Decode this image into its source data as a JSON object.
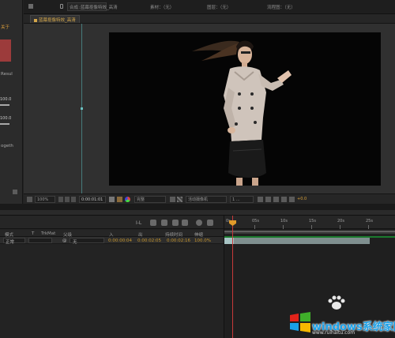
{
  "left_panel": {
    "label_top": "关于",
    "label_resul": "Resul",
    "value_1": "100.0",
    "value_2": "100.0",
    "label_bottom": "ogeth"
  },
  "comp_tabbar": {
    "tab_prefix": "合成",
    "tab_title": ":蓝幕抠像特效_高清",
    "footage_label": "素材：（无）",
    "layer_label": "图层：（无）",
    "flowchart_label": "流程图：（无）"
  },
  "subtab": {
    "label": "蓝幕抠像特效_高清"
  },
  "viewer_toolbar": {
    "zoom": "100%",
    "timecode": "0:00:01:01",
    "resolution": "完整",
    "camera": "活动摄像机",
    "views": "1 ...",
    "exposure": "+0.0"
  },
  "timeline": {
    "columns": {
      "mode": "模式",
      "track": "T",
      "trkmat": "TrkMat",
      "parent": "父级",
      "in": "入",
      "out": "出",
      "duration": "持续时间",
      "stretch": "伸缩"
    },
    "row": {
      "mode": "正常",
      "parent": "无",
      "in": "0:00:00:04",
      "out": "0:00:02:05",
      "duration": "0:00:02:16",
      "stretch": "100.0%"
    },
    "controls": {
      "timecode_glyph": "I-L"
    },
    "ruler": [
      "0s",
      "05s",
      "10s",
      "15s",
      "20s",
      "25s"
    ]
  },
  "watermark": {
    "brand": "windows系统家园",
    "site": "www.ruihaitu.com"
  },
  "colors": {
    "accent_orange": "#d8a03a",
    "playhead": "#c83a3a",
    "track_green": "#1b7a2e",
    "brand_blue": "#1aa0e8"
  }
}
